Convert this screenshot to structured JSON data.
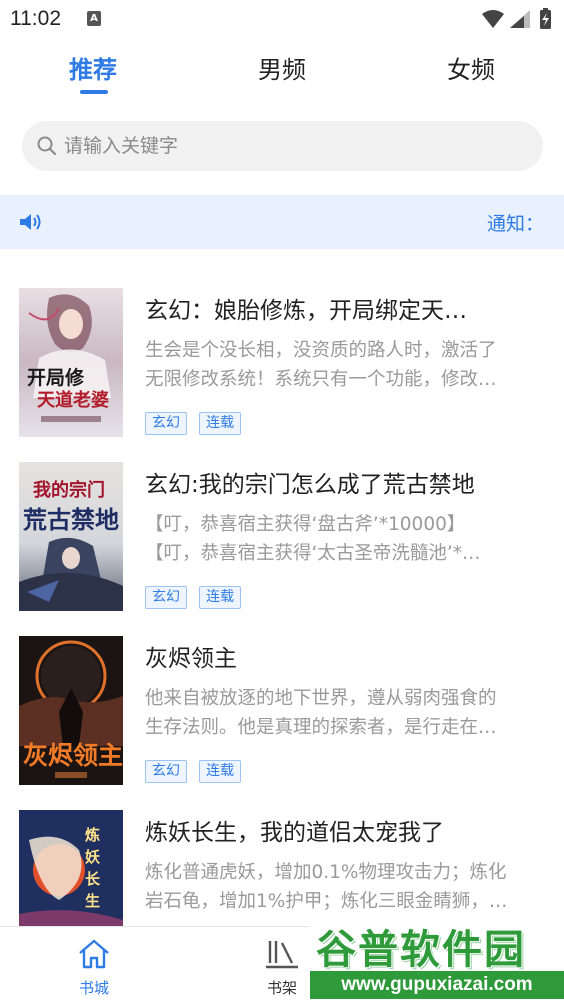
{
  "status": {
    "time": "11:02",
    "notification_letter": "A"
  },
  "tabs": [
    {
      "label": "推荐",
      "active": true
    },
    {
      "label": "男频",
      "active": false
    },
    {
      "label": "女频",
      "active": false
    }
  ],
  "search": {
    "placeholder": "请输入关键字"
  },
  "notice": {
    "label": "通知："
  },
  "books": [
    {
      "title": "玄幻：娘胎修炼，开局绑定天…",
      "desc_line1": "生会是个没长相，没资质的路人时，激活了",
      "desc_line2": "无限修改系统！系统只有一个功能，修改…",
      "tags": [
        "玄幻",
        "连载"
      ],
      "cover_text": "开局修改天道老婆"
    },
    {
      "title": "玄幻:我的宗门怎么成了荒古禁地",
      "desc_line1": "【叮，恭喜宿主获得‘盘古斧’*10000】",
      "desc_line2": "【叮，恭喜宿主获得‘太古圣帝洗髓池’*…",
      "tags": [
        "玄幻",
        "连载"
      ],
      "cover_text": "我的宗门荒古禁地"
    },
    {
      "title": "灰烬领主",
      "desc_line1": "他来自被放逐的地下世界，遵从弱肉强食的",
      "desc_line2": "生存法则。他是真理的探索者，是行走在…",
      "tags": [
        "玄幻",
        "连载"
      ],
      "cover_text": "灰烬领主"
    },
    {
      "title": "炼妖长生，我的道侣太宠我了",
      "desc_line1": "炼化普通虎妖，增加0.1%物理攻击力；炼化",
      "desc_line2": "岩石龟，增加1%护甲；炼化三眼金睛狮，…",
      "tags": [
        "玄幻",
        "连载"
      ],
      "cover_text": "炼妖长生"
    }
  ],
  "bottom_nav": [
    {
      "label": "书城",
      "active": true
    },
    {
      "label": "书架",
      "active": false
    }
  ],
  "watermark": {
    "main": "谷普软件园",
    "url": "www.gupuxiazai.com"
  },
  "colors": {
    "accent": "#2f7be5",
    "notice_bg": "#e8f1fd",
    "watermark_green": "#2e9a3a"
  }
}
